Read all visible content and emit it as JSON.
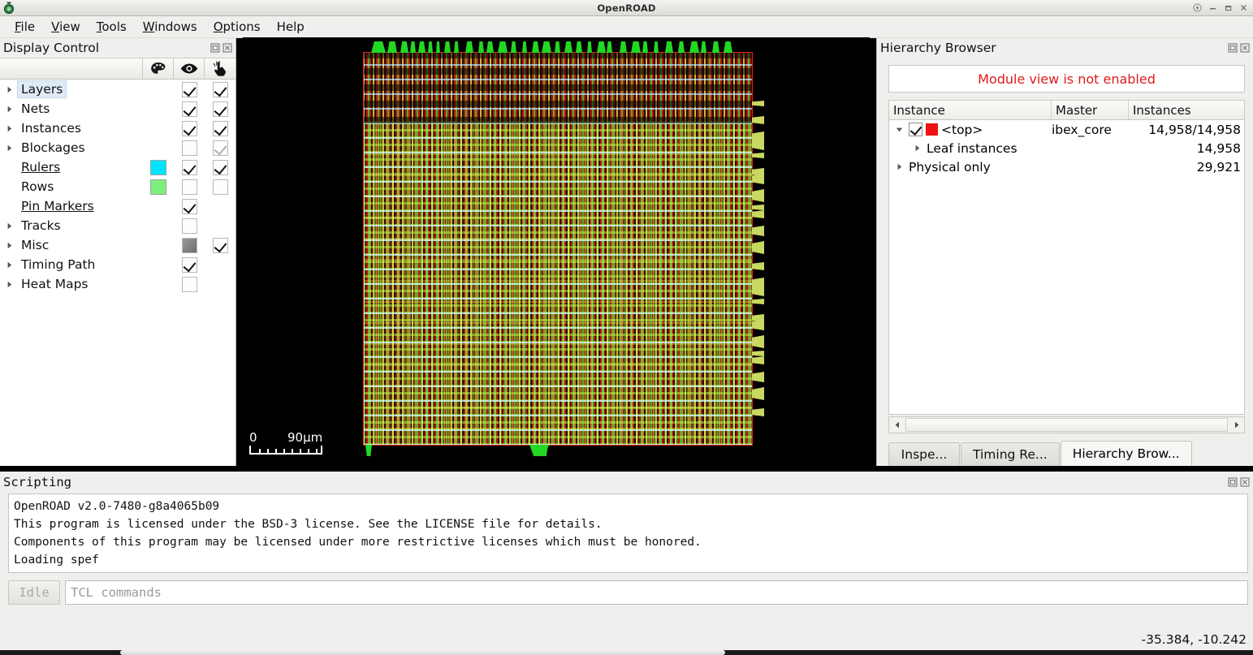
{
  "window": {
    "title": "OpenROAD",
    "app_icon": "openroad-logo-icon",
    "controls": [
      {
        "name": "shade-button",
        "glyph": "shade-icon"
      },
      {
        "name": "minimize-button",
        "glyph": "minimize-icon"
      },
      {
        "name": "maximize-button",
        "glyph": "maximize-icon"
      },
      {
        "name": "close-button",
        "glyph": "close-icon"
      }
    ]
  },
  "menubar": {
    "items": [
      {
        "label": "File",
        "accel": "F"
      },
      {
        "label": "View",
        "accel": "V"
      },
      {
        "label": "Tools",
        "accel": "T"
      },
      {
        "label": "Windows",
        "accel": "W"
      },
      {
        "label": "Options",
        "accel": "O"
      },
      {
        "label": "Help",
        "accel": "H"
      }
    ]
  },
  "display_control": {
    "title": "Display Control",
    "dock_buttons": [
      "float-icon",
      "close-icon"
    ],
    "columns": [
      {
        "name": "name-column",
        "icon": ""
      },
      {
        "name": "color-column",
        "icon": "palette-icon"
      },
      {
        "name": "visible-column",
        "icon": "eye-icon"
      },
      {
        "name": "selectable-column",
        "icon": "pointing-hand-icon"
      }
    ],
    "rows": [
      {
        "label": "Layers",
        "expandable": true,
        "underline": false,
        "selected": true,
        "swatch": null,
        "visible": "checked",
        "selectable": "checked"
      },
      {
        "label": "Nets",
        "expandable": true,
        "underline": false,
        "selected": false,
        "swatch": null,
        "visible": "checked",
        "selectable": "checked"
      },
      {
        "label": "Instances",
        "expandable": true,
        "underline": false,
        "selected": false,
        "swatch": null,
        "visible": "checked",
        "selectable": "checked"
      },
      {
        "label": "Blockages",
        "expandable": true,
        "underline": false,
        "selected": false,
        "swatch": null,
        "visible": "unchecked",
        "selectable": "checked-dim"
      },
      {
        "label": "Rulers",
        "expandable": false,
        "underline": true,
        "selected": false,
        "swatch": "#00e5ff",
        "visible": "checked",
        "selectable": "checked"
      },
      {
        "label": "Rows",
        "expandable": false,
        "underline": false,
        "selected": false,
        "swatch": "#7cf07c",
        "visible": "unchecked",
        "selectable": "unchecked"
      },
      {
        "label": "Pin Markers",
        "expandable": false,
        "underline": true,
        "selected": false,
        "swatch": null,
        "visible": "checked",
        "selectable": "none"
      },
      {
        "label": "Tracks",
        "expandable": true,
        "underline": false,
        "selected": false,
        "swatch": null,
        "visible": "unchecked",
        "selectable": "none"
      },
      {
        "label": "Misc",
        "expandable": true,
        "underline": false,
        "selected": false,
        "swatch": null,
        "visible": "filled",
        "selectable": "checked"
      },
      {
        "label": "Timing Path",
        "expandable": true,
        "underline": false,
        "selected": false,
        "swatch": null,
        "visible": "checked",
        "selectable": "none"
      },
      {
        "label": "Heat Maps",
        "expandable": true,
        "underline": false,
        "selected": false,
        "swatch": null,
        "visible": "unchecked",
        "selectable": "none"
      }
    ]
  },
  "layout_view": {
    "name": "layout-canvas",
    "scale_bar": {
      "start": "0",
      "end": "90µm"
    }
  },
  "hierarchy_browser": {
    "title": "Hierarchy Browser",
    "dock_buttons": [
      "float-icon",
      "close-icon"
    ],
    "banner": "Module view is not enabled",
    "columns": [
      "Instance",
      "Master",
      "Instances"
    ],
    "rows": [
      {
        "indent": 0,
        "expandable": true,
        "expanded": true,
        "checkbox": "checked",
        "color": "#ee1111",
        "label": "<top>",
        "master": "ibex_core",
        "instances": "14,958/14,958"
      },
      {
        "indent": 1,
        "expandable": true,
        "expanded": false,
        "checkbox": null,
        "color": null,
        "label": "Leaf instances",
        "master": "",
        "instances": "14,958"
      },
      {
        "indent": 0,
        "expandable": true,
        "expanded": false,
        "checkbox": null,
        "color": null,
        "label": "Physical only",
        "master": "",
        "instances": "29,921"
      }
    ],
    "tabs": [
      {
        "label": "Inspe...",
        "active": false
      },
      {
        "label": "Timing Re...",
        "active": false
      },
      {
        "label": "Hierarchy Brow...",
        "active": true
      }
    ]
  },
  "scripting": {
    "title": "Scripting",
    "dock_buttons": [
      "float-icon",
      "close-icon"
    ],
    "output_lines": [
      "OpenROAD v2.0-7480-g8a4065b09",
      "This program is licensed under the BSD-3 license. See the LICENSE file for details.",
      "Components of this program may be licensed under more restrictive licenses which must be honored.",
      "Loading spef"
    ],
    "status_label": "Idle",
    "input_placeholder": "TCL commands"
  },
  "statusbar": {
    "coordinates": "-35.384, -10.242"
  }
}
